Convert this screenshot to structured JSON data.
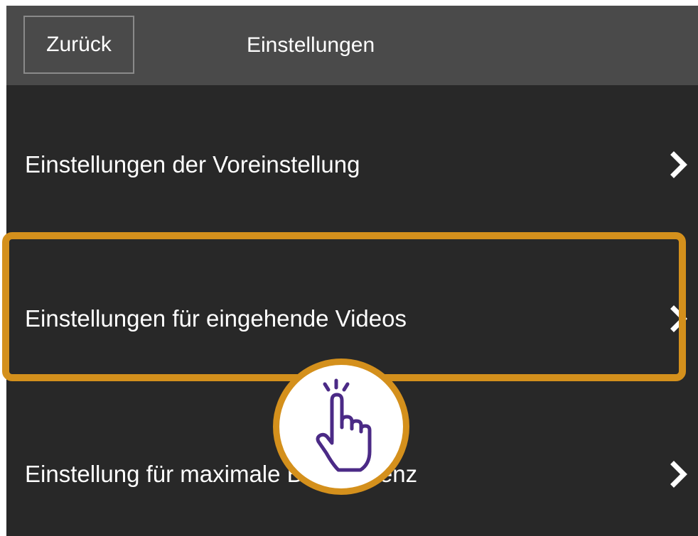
{
  "header": {
    "back_label": "Zurück",
    "title": "Einstellungen"
  },
  "menu": {
    "items": [
      {
        "label": "Einstellungen der Voreinstellung",
        "icon": "chevron-right-icon"
      },
      {
        "label": "Einstellungen für eingehende Videos",
        "icon": "chevron-right-icon",
        "highlighted": true
      },
      {
        "label": "Einstellung für maximale Bildfrequenz",
        "icon": "chevron-right-icon"
      }
    ]
  },
  "overlay": {
    "icon": "tap-hand-icon",
    "accent_color": "#d4901c",
    "hand_color": "#4b2a86"
  },
  "colors": {
    "header_bg": "#4a4a4a",
    "list_bg": "#282828",
    "text": "#ffffff",
    "highlight": "#d4901c"
  }
}
